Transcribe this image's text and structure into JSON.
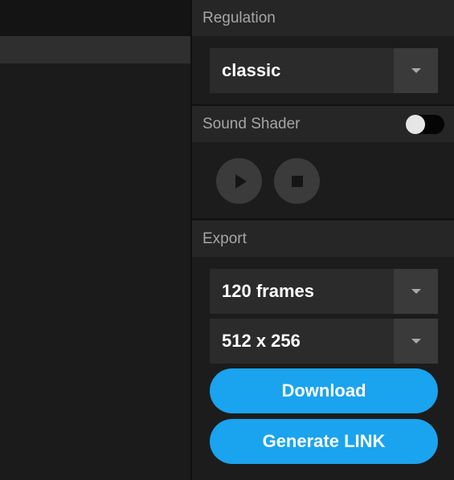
{
  "regulation": {
    "header": "Regulation",
    "select_value": "classic"
  },
  "sound_shader": {
    "header": "Sound Shader",
    "toggle_on": false
  },
  "export": {
    "header": "Export",
    "frames_value": "120 frames",
    "resolution_value": "512 x 256",
    "download_label": "Download",
    "generate_link_label": "Generate LINK"
  },
  "colors": {
    "accent": "#1aa3ee",
    "panel_bg": "#1c1c1c",
    "header_bg": "#262626"
  },
  "icons": {
    "caret": "chevron-down-icon",
    "play": "play-icon",
    "stop": "stop-icon"
  }
}
